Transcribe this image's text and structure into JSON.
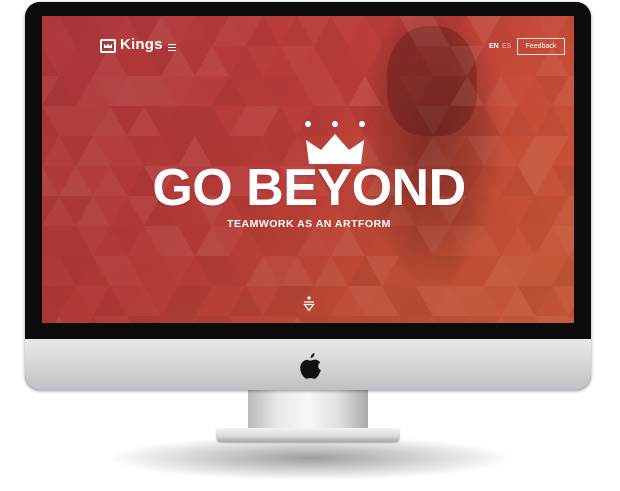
{
  "header": {
    "brand": "Kings",
    "lang_active": "EN",
    "lang_inactive": "ES",
    "feedback_label": "Feedback"
  },
  "hero": {
    "title": "GO BEYOND",
    "subtitle": "TEAMWORK AS AN ARTFORM"
  },
  "icons": {
    "logo": "crown-box-icon",
    "menu": "hamburger-menu-icon",
    "hero": "crown-icon",
    "scroll": "scroll-down-icon",
    "device": "apple-logo-icon"
  },
  "colors": {
    "accent": "#c9423d",
    "text": "#ffffff",
    "bezel": "#0b0b0b",
    "chin": "#d4d4d7"
  }
}
